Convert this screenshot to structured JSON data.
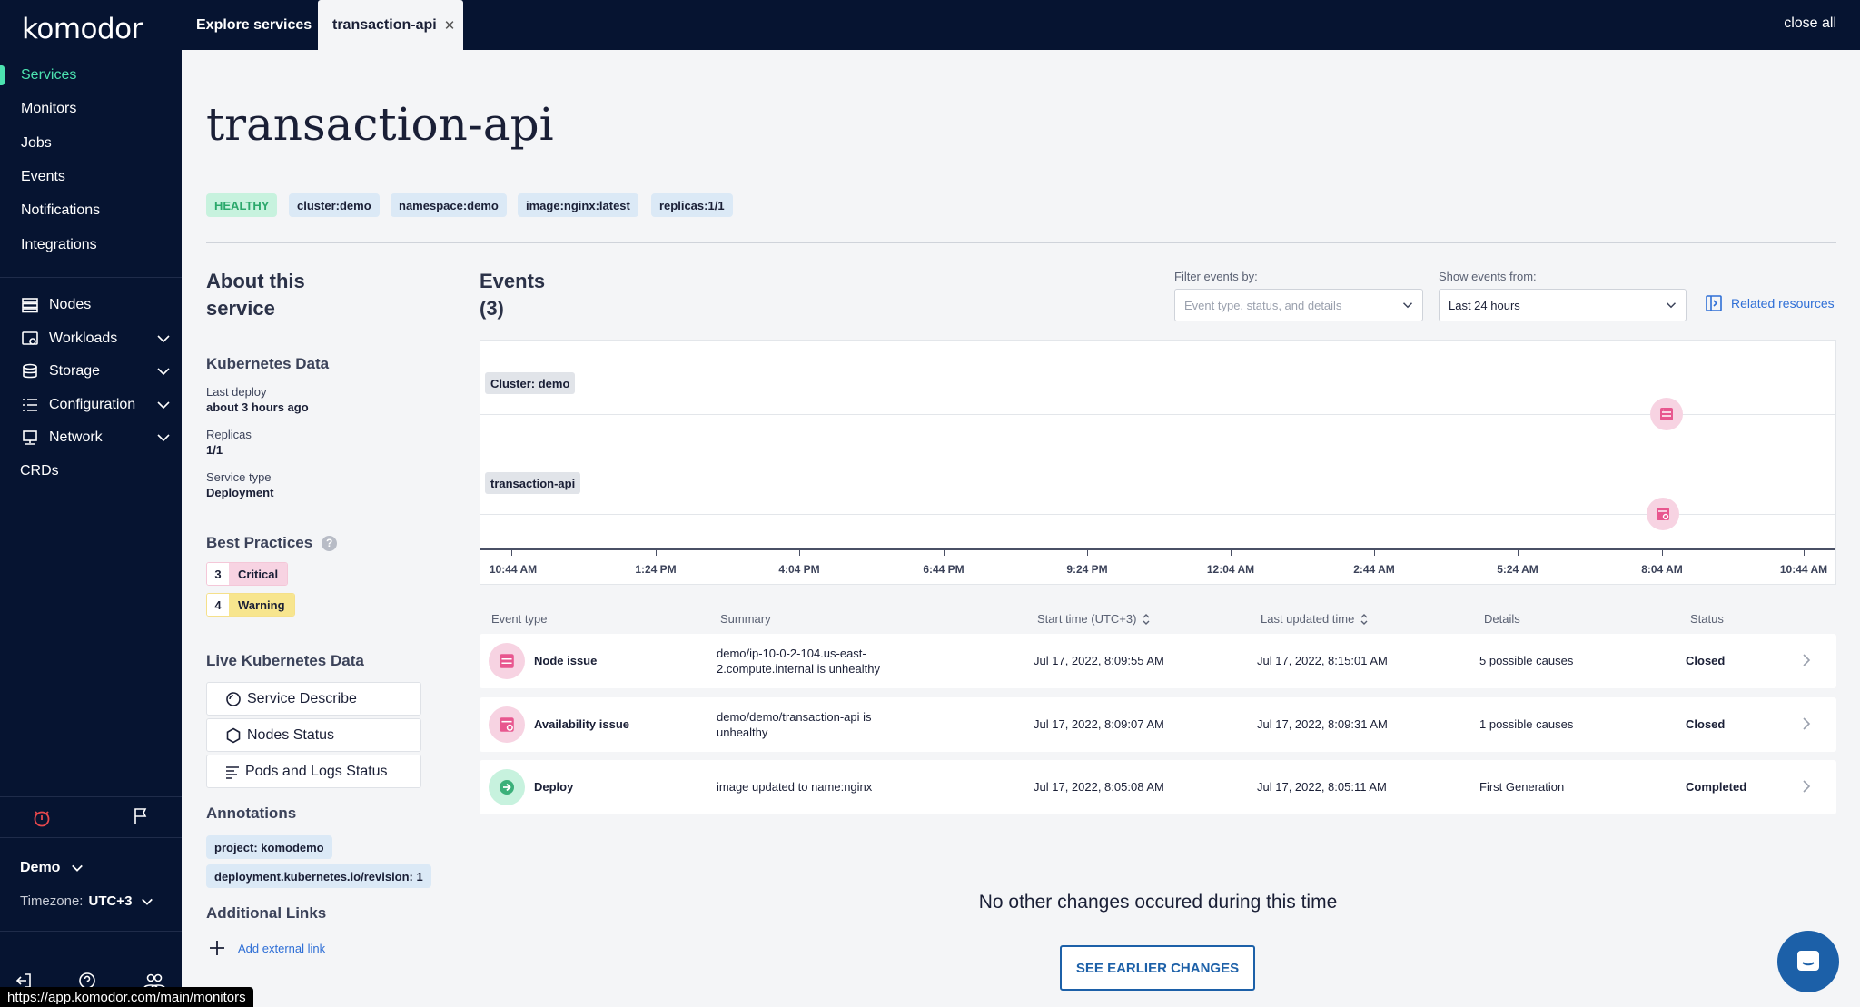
{
  "app": {
    "logo": "komodor"
  },
  "sidebar": {
    "items": [
      {
        "label": "Services"
      },
      {
        "label": "Monitors"
      },
      {
        "label": "Jobs"
      },
      {
        "label": "Events"
      },
      {
        "label": "Notifications"
      },
      {
        "label": "Integrations"
      }
    ],
    "resources": [
      {
        "label": "Nodes",
        "icon": "server-icon"
      },
      {
        "label": "Workloads",
        "icon": "workloads-icon"
      },
      {
        "label": "Storage",
        "icon": "database-icon"
      },
      {
        "label": "Configuration",
        "icon": "list-icon"
      },
      {
        "label": "Network",
        "icon": "network-icon"
      },
      {
        "label": "CRDs"
      }
    ],
    "account": "Demo",
    "timezone_label": "Timezone:",
    "timezone_value": "UTC+3"
  },
  "tabs": {
    "explore": "Explore services",
    "active": "transaction-api",
    "close_all": "close all"
  },
  "service": {
    "title": "transaction-api",
    "chips": [
      "HEALTHY",
      "cluster:demo",
      "namespace:demo",
      "image:nginx:latest",
      "replicas:1/1"
    ]
  },
  "about": {
    "title_line1": "About this",
    "title_line2": "service",
    "k8s_title": "Kubernetes Data",
    "last_deploy_label": "Last deploy",
    "last_deploy_value": "about 3 hours ago",
    "replicas_label": "Replicas",
    "replicas_value": "1/1",
    "service_type_label": "Service type",
    "service_type_value": "Deployment",
    "best_practices": "Best Practices",
    "critical_count": "3",
    "critical_label": "Critical",
    "warning_count": "4",
    "warning_label": "Warning",
    "live_title": "Live Kubernetes Data",
    "live_buttons": [
      "Service Describe",
      "Nodes Status",
      "Pods and Logs Status"
    ],
    "annotations_title": "Annotations",
    "annotations": [
      "project: komodemo",
      "deployment.kubernetes.io/revision: 1"
    ],
    "links_title": "Additional Links",
    "add_link": "Add external link"
  },
  "events": {
    "title": "Events",
    "count": "(3)",
    "filter_label": "Filter events by:",
    "filter_placeholder": "Event type, status, and details",
    "show_label": "Show events from:",
    "show_value": "Last 24 hours",
    "related": "Related resources",
    "lanes": [
      "Cluster: demo",
      "transaction-api"
    ],
    "ticks": [
      "10:44 AM",
      "1:24 PM",
      "4:04 PM",
      "6:44 PM",
      "9:24 PM",
      "12:04 AM",
      "2:44 AM",
      "5:24 AM",
      "8:04 AM",
      "10:44 AM"
    ],
    "columns": [
      "Event type",
      "Summary",
      "Start time (UTC+3)",
      "Last updated time",
      "Details",
      "Status"
    ],
    "rows": [
      {
        "type": "Node issue",
        "summary1": "demo/ip-10-0-2-104.us-east-",
        "summary2": "2.compute.internal is unhealthy",
        "start": "Jul 17, 2022, 8:09:55 AM",
        "updated": "Jul 17, 2022, 8:15:01 AM",
        "details": "5 possible causes",
        "status": "Closed",
        "icon": "server-icon",
        "color": "#f7d3e2"
      },
      {
        "type": "Availability issue",
        "summary1": "demo/demo/transaction-api is",
        "summary2": "unhealthy",
        "start": "Jul 17, 2022, 8:09:07 AM",
        "updated": "Jul 17, 2022, 8:09:31 AM",
        "details": "1 possible causes",
        "status": "Closed",
        "icon": "availability-icon",
        "color": "#f7d3e2"
      },
      {
        "type": "Deploy",
        "summary1": "image updated to name:nginx",
        "summary2": "",
        "start": "Jul 17, 2022, 8:05:08 AM",
        "updated": "Jul 17, 2022, 8:05:11 AM",
        "details": "First Generation",
        "status": "Completed",
        "icon": "deploy-icon",
        "color": "#c7f2de"
      }
    ],
    "no_changes": "No other changes occured during this time",
    "see_earlier": "SEE EARLIER CHANGES"
  },
  "statusbar": {
    "url": "https://app.komodor.com/main/monitors"
  }
}
